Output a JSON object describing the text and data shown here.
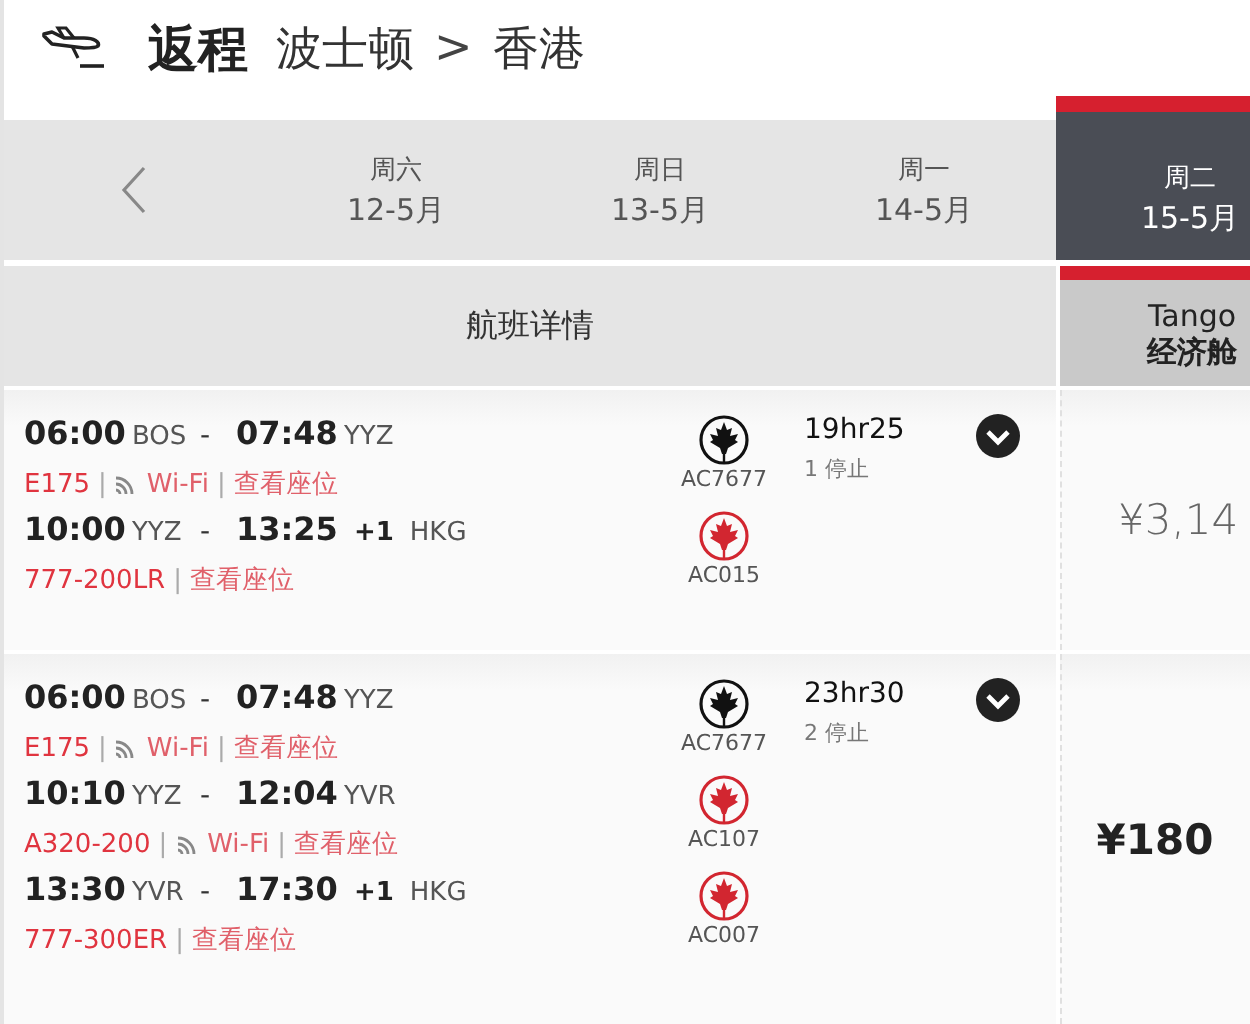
{
  "header": {
    "title": "返程",
    "origin": "波士顿",
    "separator": ">",
    "destination": "香港"
  },
  "dates": [
    {
      "weekday": "周六",
      "date": "12-5月",
      "selected": false
    },
    {
      "weekday": "周日",
      "date": "13-5月",
      "selected": false
    },
    {
      "weekday": "周一",
      "date": "14-5月",
      "selected": false
    },
    {
      "weekday": "周二",
      "date": "15-5月",
      "selected": true
    }
  ],
  "columns": {
    "details": "航班详情",
    "fare_brand": "Tango",
    "fare_cabin": "经济舱"
  },
  "flights": [
    {
      "duration": "19hr25",
      "stops": "1 停止",
      "price": "¥3,14",
      "highlighted": false,
      "segments": [
        {
          "dep_time": "06:00",
          "dep_airport": "BOS",
          "dash": "-",
          "arr_time": "07:48",
          "arr_airport": "YYZ",
          "aircraft": "E175",
          "divider": "|",
          "wifi": true,
          "wifi_label": "Wi-Fi",
          "wifi_divider": "|",
          "seats": "查看座位",
          "flight_no": "AC7677",
          "color": "#111111"
        },
        {
          "dash": "-",
          "divider": "|",
          "dep_time": "10:00",
          "dep_airport": "YYZ",
          "arr_time": "13:25",
          "day_offset": "+1",
          "arr_airport": "HKG",
          "aircraft": "777-200LR",
          "wifi": false,
          "seats": "查看座位",
          "flight_no": "AC015",
          "color": "#d22630"
        }
      ]
    },
    {
      "duration": "23hr30",
      "stops": "2 停止",
      "price": "¥180",
      "highlighted": true,
      "segments": [
        {
          "dep_time": "06:00",
          "dep_airport": "BOS",
          "dash": "-",
          "arr_time": "07:48",
          "arr_airport": "YYZ",
          "aircraft": "E175",
          "divider": "|",
          "wifi": true,
          "wifi_label": "Wi-Fi",
          "wifi_divider": "|",
          "seats": "查看座位",
          "flight_no": "AC7677",
          "color": "#111111"
        },
        {
          "dep_time": "10:10",
          "dep_airport": "YYZ",
          "dash": "-",
          "arr_time": "12:04",
          "arr_airport": "YVR",
          "aircraft": "A320-200",
          "divider": "|",
          "wifi": true,
          "wifi_label": "Wi-Fi",
          "wifi_divider": "|",
          "seats": "查看座位",
          "flight_no": "AC107",
          "color": "#d22630"
        },
        {
          "dash": "-",
          "divider": "|",
          "dep_time": "13:30",
          "dep_airport": "YVR",
          "arr_time": "17:30",
          "day_offset": "+1",
          "arr_airport": "HKG",
          "aircraft": "777-300ER",
          "wifi": false,
          "seats": "查看座位",
          "flight_no": "AC007",
          "color": "#d22630"
        }
      ]
    }
  ]
}
